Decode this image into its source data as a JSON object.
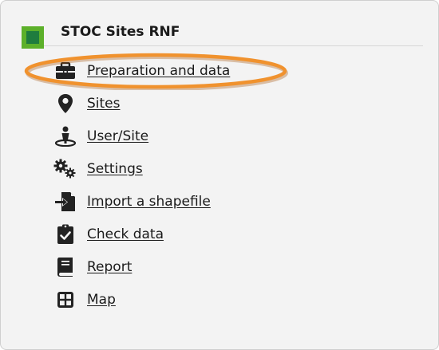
{
  "header": {
    "title": "STOC Sites RNF"
  },
  "menu": {
    "items": [
      {
        "label": "Preparation and data",
        "icon": "briefcase-icon"
      },
      {
        "label": "Sites",
        "icon": "map-pin-icon"
      },
      {
        "label": "User/Site",
        "icon": "person-location-icon"
      },
      {
        "label": "Settings",
        "icon": "gears-icon"
      },
      {
        "label": "Import a shapefile",
        "icon": "file-import-icon"
      },
      {
        "label": "Check data",
        "icon": "clipboard-check-icon"
      },
      {
        "label": "Report",
        "icon": "book-icon"
      },
      {
        "label": "Map",
        "icon": "grid-icon"
      }
    ]
  },
  "colors": {
    "logo_outer": "#5cb02a",
    "logo_inner": "#1f7c3e",
    "highlight": "#f0922e",
    "panel_background": "#f3f3f3",
    "icon_color": "#222222"
  }
}
